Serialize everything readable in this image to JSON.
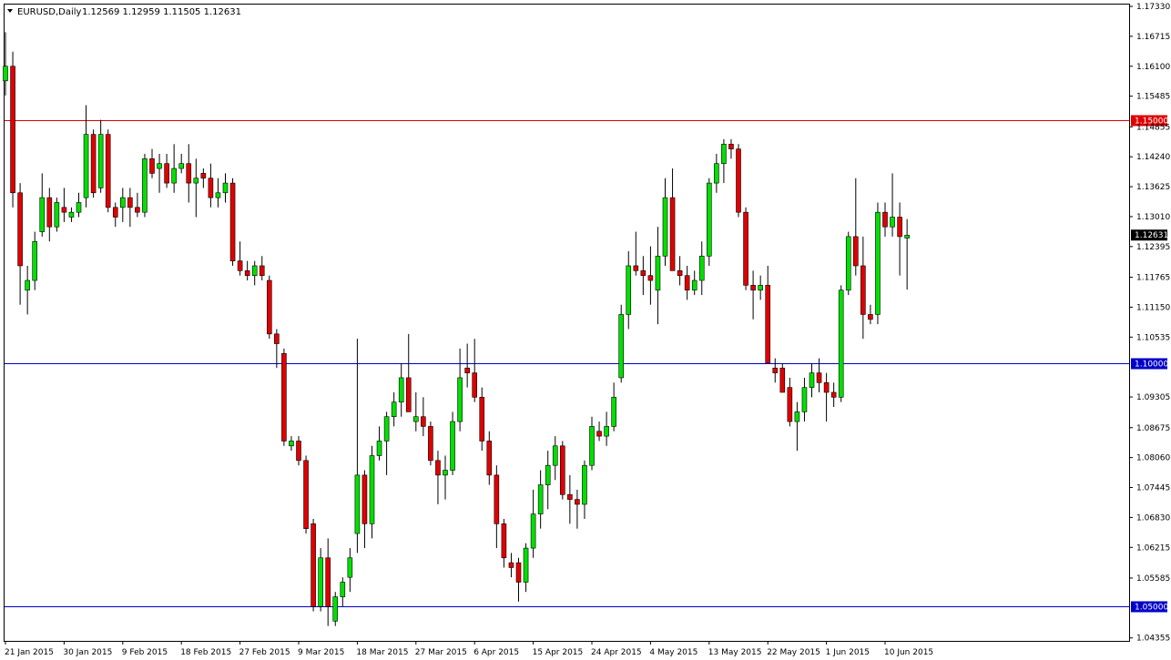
{
  "header": {
    "symbol": "EURUSD,Daily",
    "ohlc": "1.12569 1.12959 1.11505 1.12631"
  },
  "colors": {
    "background": "#ffffff",
    "axis": "#000000",
    "bull": "#00e000",
    "bear": "#e00000",
    "wick": "#000000",
    "resistance_line": "#e00000",
    "support_line": "#0000c8",
    "current_price_box": "#000000"
  },
  "chart_data": {
    "type": "candlestick",
    "title": "EURUSD,Daily",
    "ylim": [
      1.0435,
      1.1733
    ],
    "grid": false,
    "y_ticks": [
      "1.17330",
      "1.16715",
      "1.16100",
      "1.15485",
      "1.14855",
      "1.14240",
      "1.13625",
      "1.13010",
      "1.12395",
      "1.11765",
      "1.11150",
      "1.10535",
      "1.09305",
      "1.08675",
      "1.08060",
      "1.07445",
      "1.06830",
      "1.06215",
      "1.05585",
      "1.04355"
    ],
    "x_labels": [
      {
        "label": "21 Jan 2015",
        "index": 0
      },
      {
        "label": "30 Jan 2015",
        "index": 8
      },
      {
        "label": "9 Feb 2015",
        "index": 16
      },
      {
        "label": "18 Feb 2015",
        "index": 24
      },
      {
        "label": "27 Feb 2015",
        "index": 32
      },
      {
        "label": "9 Mar 2015",
        "index": 40
      },
      {
        "label": "18 Mar 2015",
        "index": 48
      },
      {
        "label": "27 Mar 2015",
        "index": 56
      },
      {
        "label": "6 Apr 2015",
        "index": 64
      },
      {
        "label": "15 Apr 2015",
        "index": 72
      },
      {
        "label": "24 Apr 2015",
        "index": 80
      },
      {
        "label": "4 May 2015",
        "index": 88
      },
      {
        "label": "13 May 2015",
        "index": 96
      },
      {
        "label": "22 May 2015",
        "index": 104
      },
      {
        "label": "1 Jun 2015",
        "index": 112
      },
      {
        "label": "10 Jun 2015",
        "index": 120
      }
    ],
    "horizontal_lines": [
      {
        "value": 1.15,
        "label": "1.15000",
        "color": "#e00000"
      },
      {
        "value": 1.1,
        "label": "1.10000",
        "color": "#0000c8"
      },
      {
        "value": 1.05,
        "label": "1.05000",
        "color": "#0000c8"
      }
    ],
    "current_price": {
      "value": 1.12631,
      "label": "1.12631"
    },
    "candles": [
      {
        "o": 1.158,
        "h": 1.168,
        "l": 1.155,
        "c": 1.161
      },
      {
        "o": 1.161,
        "h": 1.164,
        "l": 1.132,
        "c": 1.135
      },
      {
        "o": 1.135,
        "h": 1.137,
        "l": 1.112,
        "c": 1.12
      },
      {
        "o": 1.115,
        "h": 1.12,
        "l": 1.11,
        "c": 1.117
      },
      {
        "o": 1.117,
        "h": 1.127,
        "l": 1.115,
        "c": 1.125
      },
      {
        "o": 1.127,
        "h": 1.139,
        "l": 1.126,
        "c": 1.134
      },
      {
        "o": 1.134,
        "h": 1.136,
        "l": 1.125,
        "c": 1.128
      },
      {
        "o": 1.128,
        "h": 1.134,
        "l": 1.127,
        "c": 1.133
      },
      {
        "o": 1.132,
        "h": 1.136,
        "l": 1.129,
        "c": 1.131
      },
      {
        "o": 1.13,
        "h": 1.132,
        "l": 1.129,
        "c": 1.131
      },
      {
        "o": 1.131,
        "h": 1.135,
        "l": 1.13,
        "c": 1.133
      },
      {
        "o": 1.134,
        "h": 1.153,
        "l": 1.132,
        "c": 1.147
      },
      {
        "o": 1.147,
        "h": 1.148,
        "l": 1.134,
        "c": 1.135
      },
      {
        "o": 1.136,
        "h": 1.15,
        "l": 1.135,
        "c": 1.147
      },
      {
        "o": 1.147,
        "h": 1.148,
        "l": 1.131,
        "c": 1.132
      },
      {
        "o": 1.132,
        "h": 1.133,
        "l": 1.128,
        "c": 1.13
      },
      {
        "o": 1.132,
        "h": 1.136,
        "l": 1.129,
        "c": 1.134
      },
      {
        "o": 1.134,
        "h": 1.136,
        "l": 1.128,
        "c": 1.132
      },
      {
        "o": 1.132,
        "h": 1.135,
        "l": 1.13,
        "c": 1.131
      },
      {
        "o": 1.131,
        "h": 1.143,
        "l": 1.13,
        "c": 1.142
      },
      {
        "o": 1.142,
        "h": 1.144,
        "l": 1.138,
        "c": 1.139
      },
      {
        "o": 1.14,
        "h": 1.143,
        "l": 1.135,
        "c": 1.141
      },
      {
        "o": 1.141,
        "h": 1.143,
        "l": 1.136,
        "c": 1.137
      },
      {
        "o": 1.137,
        "h": 1.145,
        "l": 1.135,
        "c": 1.14
      },
      {
        "o": 1.14,
        "h": 1.143,
        "l": 1.139,
        "c": 1.141
      },
      {
        "o": 1.141,
        "h": 1.145,
        "l": 1.133,
        "c": 1.137
      },
      {
        "o": 1.137,
        "h": 1.142,
        "l": 1.13,
        "c": 1.138
      },
      {
        "o": 1.139,
        "h": 1.14,
        "l": 1.136,
        "c": 1.138
      },
      {
        "o": 1.138,
        "h": 1.141,
        "l": 1.132,
        "c": 1.134
      },
      {
        "o": 1.134,
        "h": 1.138,
        "l": 1.132,
        "c": 1.135
      },
      {
        "o": 1.135,
        "h": 1.139,
        "l": 1.133,
        "c": 1.137
      },
      {
        "o": 1.137,
        "h": 1.138,
        "l": 1.12,
        "c": 1.121
      },
      {
        "o": 1.121,
        "h": 1.125,
        "l": 1.118,
        "c": 1.119
      },
      {
        "o": 1.119,
        "h": 1.121,
        "l": 1.117,
        "c": 1.118
      },
      {
        "o": 1.118,
        "h": 1.121,
        "l": 1.116,
        "c": 1.12
      },
      {
        "o": 1.12,
        "h": 1.122,
        "l": 1.117,
        "c": 1.118
      },
      {
        "o": 1.117,
        "h": 1.118,
        "l": 1.105,
        "c": 1.106
      },
      {
        "o": 1.106,
        "h": 1.107,
        "l": 1.099,
        "c": 1.104
      },
      {
        "o": 1.102,
        "h": 1.103,
        "l": 1.083,
        "c": 1.084
      },
      {
        "o": 1.083,
        "h": 1.085,
        "l": 1.082,
        "c": 1.084
      },
      {
        "o": 1.084,
        "h": 1.085,
        "l": 1.079,
        "c": 1.08
      },
      {
        "o": 1.08,
        "h": 1.081,
        "l": 1.065,
        "c": 1.066
      },
      {
        "o": 1.067,
        "h": 1.068,
        "l": 1.049,
        "c": 1.05
      },
      {
        "o": 1.05,
        "h": 1.062,
        "l": 1.049,
        "c": 1.06
      },
      {
        "o": 1.06,
        "h": 1.064,
        "l": 1.046,
        "c": 1.05
      },
      {
        "o": 1.047,
        "h": 1.053,
        "l": 1.046,
        "c": 1.052
      },
      {
        "o": 1.052,
        "h": 1.056,
        "l": 1.05,
        "c": 1.055
      },
      {
        "o": 1.056,
        "h": 1.062,
        "l": 1.053,
        "c": 1.06
      },
      {
        "o": 1.065,
        "h": 1.105,
        "l": 1.061,
        "c": 1.077
      },
      {
        "o": 1.077,
        "h": 1.078,
        "l": 1.062,
        "c": 1.067
      },
      {
        "o": 1.067,
        "h": 1.083,
        "l": 1.064,
        "c": 1.081
      },
      {
        "o": 1.081,
        "h": 1.087,
        "l": 1.08,
        "c": 1.084
      },
      {
        "o": 1.084,
        "h": 1.09,
        "l": 1.077,
        "c": 1.089
      },
      {
        "o": 1.089,
        "h": 1.094,
        "l": 1.087,
        "c": 1.092
      },
      {
        "o": 1.092,
        "h": 1.1,
        "l": 1.089,
        "c": 1.097
      },
      {
        "o": 1.097,
        "h": 1.106,
        "l": 1.092,
        "c": 1.09
      },
      {
        "o": 1.088,
        "h": 1.094,
        "l": 1.086,
        "c": 1.089
      },
      {
        "o": 1.089,
        "h": 1.093,
        "l": 1.085,
        "c": 1.087
      },
      {
        "o": 1.087,
        "h": 1.088,
        "l": 1.079,
        "c": 1.08
      },
      {
        "o": 1.08,
        "h": 1.082,
        "l": 1.071,
        "c": 1.077
      },
      {
        "o": 1.077,
        "h": 1.081,
        "l": 1.072,
        "c": 1.078
      },
      {
        "o": 1.078,
        "h": 1.09,
        "l": 1.077,
        "c": 1.088
      },
      {
        "o": 1.088,
        "h": 1.103,
        "l": 1.086,
        "c": 1.097
      },
      {
        "o": 1.099,
        "h": 1.104,
        "l": 1.095,
        "c": 1.098
      },
      {
        "o": 1.098,
        "h": 1.105,
        "l": 1.092,
        "c": 1.093
      },
      {
        "o": 1.093,
        "h": 1.095,
        "l": 1.082,
        "c": 1.084
      },
      {
        "o": 1.084,
        "h": 1.086,
        "l": 1.075,
        "c": 1.077
      },
      {
        "o": 1.077,
        "h": 1.079,
        "l": 1.062,
        "c": 1.067
      },
      {
        "o": 1.067,
        "h": 1.068,
        "l": 1.058,
        "c": 1.06
      },
      {
        "o": 1.059,
        "h": 1.061,
        "l": 1.056,
        "c": 1.058
      },
      {
        "o": 1.059,
        "h": 1.06,
        "l": 1.051,
        "c": 1.055
      },
      {
        "o": 1.055,
        "h": 1.063,
        "l": 1.053,
        "c": 1.062
      },
      {
        "o": 1.062,
        "h": 1.074,
        "l": 1.06,
        "c": 1.069
      },
      {
        "o": 1.069,
        "h": 1.078,
        "l": 1.066,
        "c": 1.075
      },
      {
        "o": 1.075,
        "h": 1.082,
        "l": 1.07,
        "c": 1.079
      },
      {
        "o": 1.079,
        "h": 1.085,
        "l": 1.076,
        "c": 1.083
      },
      {
        "o": 1.083,
        "h": 1.084,
        "l": 1.072,
        "c": 1.073
      },
      {
        "o": 1.073,
        "h": 1.077,
        "l": 1.067,
        "c": 1.072
      },
      {
        "o": 1.072,
        "h": 1.074,
        "l": 1.066,
        "c": 1.071
      },
      {
        "o": 1.071,
        "h": 1.08,
        "l": 1.068,
        "c": 1.079
      },
      {
        "o": 1.079,
        "h": 1.089,
        "l": 1.078,
        "c": 1.087
      },
      {
        "o": 1.086,
        "h": 1.088,
        "l": 1.084,
        "c": 1.085
      },
      {
        "o": 1.085,
        "h": 1.09,
        "l": 1.083,
        "c": 1.087
      },
      {
        "o": 1.087,
        "h": 1.096,
        "l": 1.086,
        "c": 1.093
      },
      {
        "o": 1.097,
        "h": 1.112,
        "l": 1.096,
        "c": 1.11
      },
      {
        "o": 1.11,
        "h": 1.123,
        "l": 1.107,
        "c": 1.12
      },
      {
        "o": 1.12,
        "h": 1.127,
        "l": 1.118,
        "c": 1.119
      },
      {
        "o": 1.119,
        "h": 1.122,
        "l": 1.114,
        "c": 1.118
      },
      {
        "o": 1.118,
        "h": 1.124,
        "l": 1.112,
        "c": 1.117
      },
      {
        "o": 1.115,
        "h": 1.128,
        "l": 1.108,
        "c": 1.122
      },
      {
        "o": 1.122,
        "h": 1.138,
        "l": 1.12,
        "c": 1.134
      },
      {
        "o": 1.134,
        "h": 1.14,
        "l": 1.119,
        "c": 1.119
      },
      {
        "o": 1.119,
        "h": 1.122,
        "l": 1.116,
        "c": 1.118
      },
      {
        "o": 1.118,
        "h": 1.12,
        "l": 1.113,
        "c": 1.115
      },
      {
        "o": 1.115,
        "h": 1.119,
        "l": 1.114,
        "c": 1.117
      },
      {
        "o": 1.117,
        "h": 1.125,
        "l": 1.114,
        "c": 1.122
      },
      {
        "o": 1.122,
        "h": 1.138,
        "l": 1.12,
        "c": 1.137
      },
      {
        "o": 1.137,
        "h": 1.143,
        "l": 1.135,
        "c": 1.141
      },
      {
        "o": 1.141,
        "h": 1.146,
        "l": 1.137,
        "c": 1.145
      },
      {
        "o": 1.145,
        "h": 1.146,
        "l": 1.142,
        "c": 1.144
      },
      {
        "o": 1.144,
        "h": 1.145,
        "l": 1.13,
        "c": 1.131
      },
      {
        "o": 1.131,
        "h": 1.132,
        "l": 1.115,
        "c": 1.116
      },
      {
        "o": 1.116,
        "h": 1.119,
        "l": 1.109,
        "c": 1.115
      },
      {
        "o": 1.115,
        "h": 1.118,
        "l": 1.113,
        "c": 1.116
      },
      {
        "o": 1.116,
        "h": 1.12,
        "l": 1.1,
        "c": 1.1
      },
      {
        "o": 1.099,
        "h": 1.101,
        "l": 1.096,
        "c": 1.098
      },
      {
        "o": 1.099,
        "h": 1.1,
        "l": 1.094,
        "c": 1.094
      },
      {
        "o": 1.095,
        "h": 1.097,
        "l": 1.087,
        "c": 1.088
      },
      {
        "o": 1.088,
        "h": 1.092,
        "l": 1.082,
        "c": 1.09
      },
      {
        "o": 1.09,
        "h": 1.097,
        "l": 1.088,
        "c": 1.095
      },
      {
        "o": 1.095,
        "h": 1.1,
        "l": 1.093,
        "c": 1.098
      },
      {
        "o": 1.098,
        "h": 1.101,
        "l": 1.094,
        "c": 1.096
      },
      {
        "o": 1.096,
        "h": 1.098,
        "l": 1.088,
        "c": 1.094
      },
      {
        "o": 1.094,
        "h": 1.096,
        "l": 1.091,
        "c": 1.093
      },
      {
        "o": 1.093,
        "h": 1.116,
        "l": 1.092,
        "c": 1.115
      },
      {
        "o": 1.115,
        "h": 1.127,
        "l": 1.114,
        "c": 1.126
      },
      {
        "o": 1.126,
        "h": 1.138,
        "l": 1.118,
        "c": 1.12
      },
      {
        "o": 1.12,
        "h": 1.126,
        "l": 1.105,
        "c": 1.11
      },
      {
        "o": 1.11,
        "h": 1.112,
        "l": 1.108,
        "c": 1.109
      },
      {
        "o": 1.11,
        "h": 1.133,
        "l": 1.108,
        "c": 1.131
      },
      {
        "o": 1.131,
        "h": 1.133,
        "l": 1.126,
        "c": 1.128
      },
      {
        "o": 1.128,
        "h": 1.139,
        "l": 1.126,
        "c": 1.13
      },
      {
        "o": 1.13,
        "h": 1.133,
        "l": 1.118,
        "c": 1.126
      },
      {
        "o": 1.1257,
        "h": 1.1296,
        "l": 1.1151,
        "c": 1.1263
      }
    ]
  }
}
